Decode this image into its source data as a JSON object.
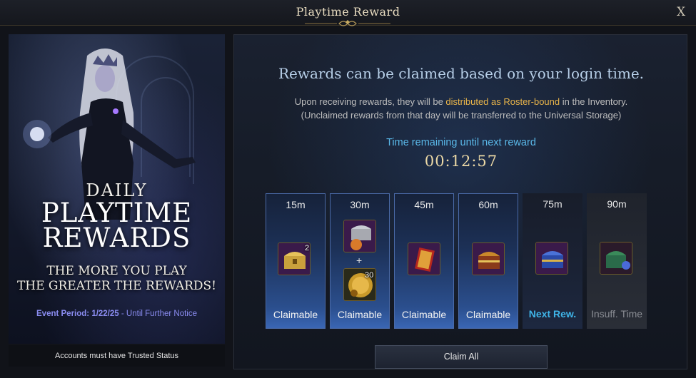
{
  "window": {
    "title": "Playtime Reward",
    "close_label": "X"
  },
  "banner": {
    "line_daily": "DAILY",
    "line_playtime": "PLAYTIME",
    "line_rewards": "REWARDS",
    "tagline_1": "THE MORE YOU PLAY",
    "tagline_2": "THE GREATER THE REWARDS!",
    "period_prefix": "Event Period: 1/22/25",
    "period_suffix": " - Until Further Notice",
    "footer": "Accounts must have Trusted Status"
  },
  "panel": {
    "headline": "Rewards can be claimed based on your login time.",
    "desc_1_before": "Upon receiving rewards, they will be ",
    "desc_1_highlight": "distributed as Roster-bound",
    "desc_1_after": " in the Inventory.",
    "desc_2": "(Unclaimed rewards from that day will be transferred to the Universal Storage)",
    "remaining_label": "Time remaining until next reward",
    "timer": "00:12:57",
    "plus": "+",
    "claim_all": "Claim All"
  },
  "rewards": [
    {
      "time": "15m",
      "status": "Claimable",
      "state": "claimed",
      "items": [
        {
          "icon": "gold-chest-icon",
          "qty": "2"
        }
      ]
    },
    {
      "time": "30m",
      "status": "Claimable",
      "state": "claimed",
      "items": [
        {
          "icon": "silver-chest-pouch-icon",
          "qty": ""
        },
        {
          "icon": "gold-coin-icon",
          "qty": "30"
        }
      ]
    },
    {
      "time": "45m",
      "status": "Claimable",
      "state": "claimed",
      "items": [
        {
          "icon": "red-card-icon",
          "qty": ""
        }
      ]
    },
    {
      "time": "60m",
      "status": "Claimable",
      "state": "claimed",
      "items": [
        {
          "icon": "ornate-chest-icon",
          "qty": ""
        }
      ]
    },
    {
      "time": "75m",
      "status": "Next Rew.",
      "state": "next",
      "items": [
        {
          "icon": "blue-chest-icon",
          "qty": ""
        }
      ]
    },
    {
      "time": "90m",
      "status": "Insuff. Time",
      "state": "insufficient",
      "items": [
        {
          "icon": "green-chest-icon",
          "qty": ""
        }
      ]
    }
  ],
  "colors": {
    "accent_blue": "#3fb4e8",
    "highlight_gold": "#e8b44a",
    "timer_gold": "#ecd9a6",
    "period_purple": "#8a8cf0"
  }
}
